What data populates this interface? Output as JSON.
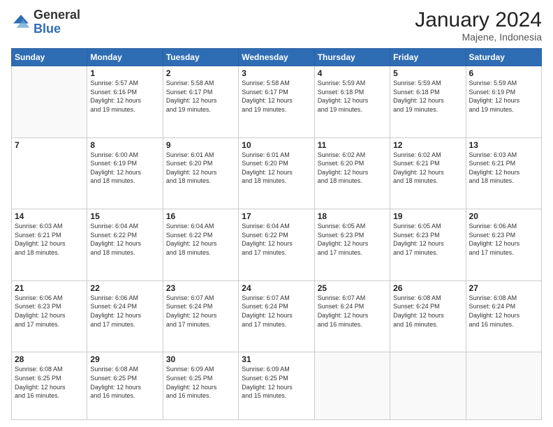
{
  "header": {
    "logo_general": "General",
    "logo_blue": "Blue",
    "month_year": "January 2024",
    "location": "Majene, Indonesia"
  },
  "days_of_week": [
    "Sunday",
    "Monday",
    "Tuesday",
    "Wednesday",
    "Thursday",
    "Friday",
    "Saturday"
  ],
  "weeks": [
    [
      {
        "day": "",
        "info": ""
      },
      {
        "day": "1",
        "info": "Sunrise: 5:57 AM\nSunset: 6:16 PM\nDaylight: 12 hours\nand 19 minutes."
      },
      {
        "day": "2",
        "info": "Sunrise: 5:58 AM\nSunset: 6:17 PM\nDaylight: 12 hours\nand 19 minutes."
      },
      {
        "day": "3",
        "info": "Sunrise: 5:58 AM\nSunset: 6:17 PM\nDaylight: 12 hours\nand 19 minutes."
      },
      {
        "day": "4",
        "info": "Sunrise: 5:59 AM\nSunset: 6:18 PM\nDaylight: 12 hours\nand 19 minutes."
      },
      {
        "day": "5",
        "info": "Sunrise: 5:59 AM\nSunset: 6:18 PM\nDaylight: 12 hours\nand 19 minutes."
      },
      {
        "day": "6",
        "info": "Sunrise: 5:59 AM\nSunset: 6:19 PM\nDaylight: 12 hours\nand 19 minutes."
      }
    ],
    [
      {
        "day": "7",
        "info": ""
      },
      {
        "day": "8",
        "info": "Sunrise: 6:00 AM\nSunset: 6:19 PM\nDaylight: 12 hours\nand 18 minutes."
      },
      {
        "day": "9",
        "info": "Sunrise: 6:01 AM\nSunset: 6:20 PM\nDaylight: 12 hours\nand 18 minutes."
      },
      {
        "day": "10",
        "info": "Sunrise: 6:01 AM\nSunset: 6:20 PM\nDaylight: 12 hours\nand 18 minutes."
      },
      {
        "day": "11",
        "info": "Sunrise: 6:02 AM\nSunset: 6:20 PM\nDaylight: 12 hours\nand 18 minutes."
      },
      {
        "day": "12",
        "info": "Sunrise: 6:02 AM\nSunset: 6:21 PM\nDaylight: 12 hours\nand 18 minutes."
      },
      {
        "day": "13",
        "info": "Sunrise: 6:03 AM\nSunset: 6:21 PM\nDaylight: 12 hours\nand 18 minutes."
      }
    ],
    [
      {
        "day": "14",
        "info": "Sunrise: 6:03 AM\nSunset: 6:21 PM\nDaylight: 12 hours\nand 18 minutes."
      },
      {
        "day": "15",
        "info": "Sunrise: 6:04 AM\nSunset: 6:22 PM\nDaylight: 12 hours\nand 18 minutes."
      },
      {
        "day": "16",
        "info": "Sunrise: 6:04 AM\nSunset: 6:22 PM\nDaylight: 12 hours\nand 18 minutes."
      },
      {
        "day": "17",
        "info": "Sunrise: 6:04 AM\nSunset: 6:22 PM\nDaylight: 12 hours\nand 17 minutes."
      },
      {
        "day": "18",
        "info": "Sunrise: 6:05 AM\nSunset: 6:23 PM\nDaylight: 12 hours\nand 17 minutes."
      },
      {
        "day": "19",
        "info": "Sunrise: 6:05 AM\nSunset: 6:23 PM\nDaylight: 12 hours\nand 17 minutes."
      },
      {
        "day": "20",
        "info": "Sunrise: 6:06 AM\nSunset: 6:23 PM\nDaylight: 12 hours\nand 17 minutes."
      }
    ],
    [
      {
        "day": "21",
        "info": "Sunrise: 6:06 AM\nSunset: 6:23 PM\nDaylight: 12 hours\nand 17 minutes."
      },
      {
        "day": "22",
        "info": "Sunrise: 6:06 AM\nSunset: 6:24 PM\nDaylight: 12 hours\nand 17 minutes."
      },
      {
        "day": "23",
        "info": "Sunrise: 6:07 AM\nSunset: 6:24 PM\nDaylight: 12 hours\nand 17 minutes."
      },
      {
        "day": "24",
        "info": "Sunrise: 6:07 AM\nSunset: 6:24 PM\nDaylight: 12 hours\nand 17 minutes."
      },
      {
        "day": "25",
        "info": "Sunrise: 6:07 AM\nSunset: 6:24 PM\nDaylight: 12 hours\nand 16 minutes."
      },
      {
        "day": "26",
        "info": "Sunrise: 6:08 AM\nSunset: 6:24 PM\nDaylight: 12 hours\nand 16 minutes."
      },
      {
        "day": "27",
        "info": "Sunrise: 6:08 AM\nSunset: 6:24 PM\nDaylight: 12 hours\nand 16 minutes."
      }
    ],
    [
      {
        "day": "28",
        "info": "Sunrise: 6:08 AM\nSunset: 6:25 PM\nDaylight: 12 hours\nand 16 minutes."
      },
      {
        "day": "29",
        "info": "Sunrise: 6:08 AM\nSunset: 6:25 PM\nDaylight: 12 hours\nand 16 minutes."
      },
      {
        "day": "30",
        "info": "Sunrise: 6:09 AM\nSunset: 6:25 PM\nDaylight: 12 hours\nand 16 minutes."
      },
      {
        "day": "31",
        "info": "Sunrise: 6:09 AM\nSunset: 6:25 PM\nDaylight: 12 hours\nand 15 minutes."
      },
      {
        "day": "",
        "info": ""
      },
      {
        "day": "",
        "info": ""
      },
      {
        "day": "",
        "info": ""
      }
    ]
  ]
}
